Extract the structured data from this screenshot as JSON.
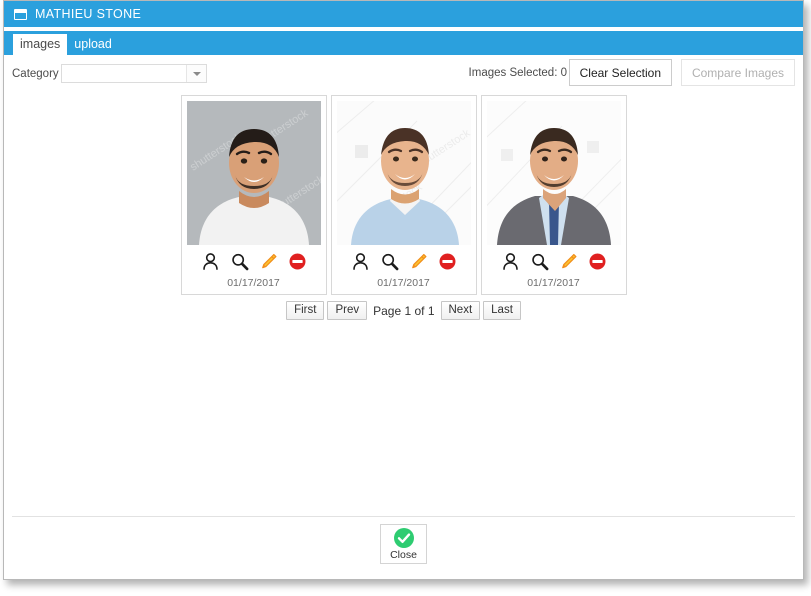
{
  "window": {
    "title": "MATHIEU STONE",
    "icon": "window-icon"
  },
  "tabs": [
    {
      "label": "images",
      "active": true
    },
    {
      "label": "upload",
      "active": false
    }
  ],
  "toolbar": {
    "category_label": "Category",
    "category_value": "",
    "category_placeholder": "",
    "dropdown_icon": "chevron-down-icon",
    "selected_count_text": "Images Selected: 0",
    "clear_selection_label": "Clear Selection",
    "compare_images_label": "Compare Images"
  },
  "cards": [
    {
      "date": "01/17/2017",
      "background": "#b5b9bc",
      "shirt": "#f2f2f2",
      "hair": "#241c18",
      "skin": "#d9a077",
      "actions": [
        {
          "name": "assign-person-icon",
          "label": "person"
        },
        {
          "name": "view-image-icon",
          "label": "search"
        },
        {
          "name": "edit-image-icon",
          "label": "edit"
        },
        {
          "name": "delete-image-icon",
          "label": "delete"
        }
      ]
    },
    {
      "date": "01/17/2017",
      "background": "#fbfbfb",
      "shirt": "#b9d2e8",
      "hair": "#4a3226",
      "skin": "#e8b48d",
      "actions": [
        {
          "name": "assign-person-icon",
          "label": "person"
        },
        {
          "name": "view-image-icon",
          "label": "search"
        },
        {
          "name": "edit-image-icon",
          "label": "edit"
        },
        {
          "name": "delete-image-icon",
          "label": "delete"
        }
      ]
    },
    {
      "date": "01/17/2017",
      "background": "#fcfcfc",
      "shirt": "#6a6a70",
      "hair": "#3a2a20",
      "skin": "#e3ad86",
      "actions": [
        {
          "name": "assign-person-icon",
          "label": "person"
        },
        {
          "name": "view-image-icon",
          "label": "search"
        },
        {
          "name": "edit-image-icon",
          "label": "edit"
        },
        {
          "name": "delete-image-icon",
          "label": "delete"
        }
      ]
    }
  ],
  "pagination": {
    "first_label": "First",
    "prev_label": "Prev",
    "page_indicator": "Page 1 of 1",
    "next_label": "Next",
    "last_label": "Last"
  },
  "footer": {
    "close_label": "Close",
    "close_icon": "green-check-circle-icon"
  },
  "colors": {
    "header_blue": "#2ba0dd",
    "accent_green": "#2ecc71",
    "delete_red": "#e02020",
    "edit_orange": "#f5a623"
  }
}
